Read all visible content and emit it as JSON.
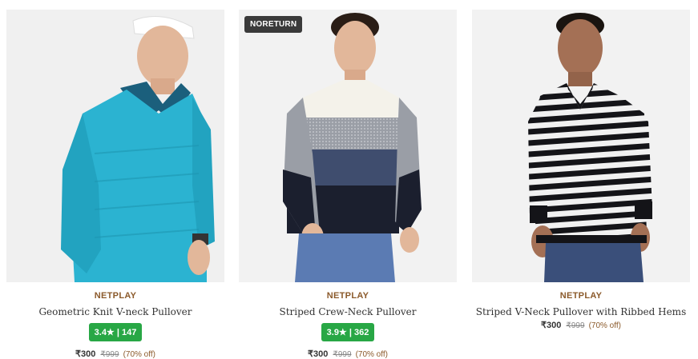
{
  "products": [
    {
      "brand": "NETPLAY",
      "name": "Geometric Knit V-neck Pullover",
      "rating": "3.4★ | 147",
      "price": "₹300",
      "mrp": "₹999",
      "discount": "(70% off)",
      "tag": "",
      "sweater_color": "#2bb3d1"
    },
    {
      "brand": "NETPLAY",
      "name": "Striped Crew-Neck Pullover",
      "rating": "3.9★ | 362",
      "price": "₹300",
      "mrp": "₹999",
      "discount": "(70% off)",
      "tag": "NORETURN"
    },
    {
      "brand": "NETPLAY",
      "name": "Striped V-Neck Pullover with Ribbed Hems",
      "price": "₹300",
      "mrp": "₹999",
      "discount": "(70% off)",
      "tag": ""
    }
  ],
  "colors": {
    "brand": "#8b5a2b",
    "rating_bg": "#28a745",
    "tag_bg": "#3a3a3a"
  }
}
